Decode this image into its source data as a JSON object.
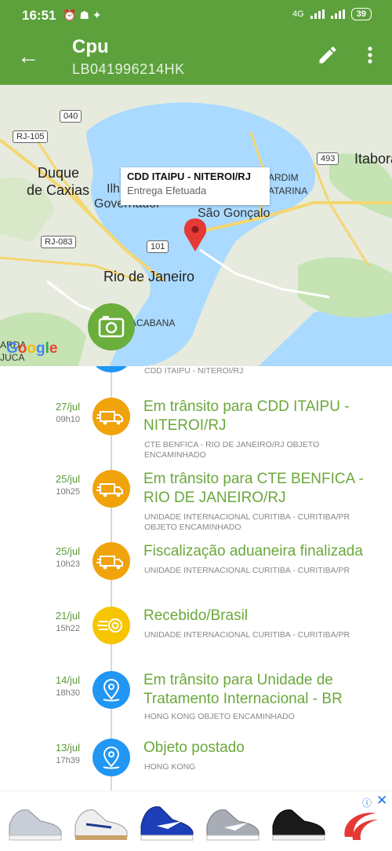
{
  "status_bar": {
    "time": "16:51",
    "network": "4G",
    "battery": "39"
  },
  "header": {
    "title": "Cpu",
    "tracking_code": "LB041996214HK"
  },
  "map": {
    "infowindow_title": "CDD ITAIPU - NITEROI/RJ",
    "infowindow_subtitle": "Entrega Efetuada",
    "labels": {
      "duque": "Duque",
      "caxias": "de Caxias",
      "ilha": "Ilh",
      "governador": "Governador",
      "sao_goncalo": "São Gonçalo",
      "rio": "Rio de Janeiro",
      "itabora": "Itabora",
      "rj105": "RJ-105",
      "rj083": "RJ-083",
      "r040": "040",
      "r101": "101",
      "r493": "493",
      "ardim": "ARDIM",
      "atarina": "ATARINA",
      "cabana": "ACABANA",
      "tijuca_a": "ARDA",
      "tijuca_b": "JUCA",
      "google": "Google"
    },
    "colors": {
      "water": "#aadaff",
      "land": "#e6ebde",
      "park": "#c5e3b3",
      "road": "#f5d670"
    }
  },
  "timeline": {
    "partial_desc": "CDD ITAIPU - NITEROI/RJ",
    "events": [
      {
        "date": "27/jul",
        "time": "09h10",
        "title": "Em trânsito para CDD ITAIPU - NITEROI/RJ",
        "desc": "CTE BENFICA - RIO DE JANEIRO/RJ OBJETO ENCAMINHADO",
        "icon": "truck-icon"
      },
      {
        "date": "25/jul",
        "time": "10h25",
        "title": "Em trânsito para CTE BENFICA - RIO DE JANEIRO/RJ",
        "desc": "UNIDADE INTERNACIONAL CURITIBA - CURITIBA/PR OBJETO ENCAMINHADO",
        "icon": "truck-icon"
      },
      {
        "date": "25/jul",
        "time": "10h23",
        "title": "Fiscalização aduaneira finalizada",
        "desc": "UNIDADE INTERNACIONAL CURITIBA - CURITIBA/PR",
        "icon": "truck-icon"
      },
      {
        "date": "21/jul",
        "time": "15h22",
        "title": "Recebido/Brasil",
        "desc": "UNIDADE INTERNACIONAL CURITIBA - CURITIBA/PR",
        "icon": "received-icon"
      },
      {
        "date": "14/jul",
        "time": "18h30",
        "title": "Em trânsito para Unidade de Tratamento Internacional - BR",
        "desc": "HONG KONG OBJETO ENCAMINHADO",
        "icon": "location-icon"
      },
      {
        "date": "13/jul",
        "time": "17h39",
        "title": "Objeto postado",
        "desc": "HONG KONG",
        "icon": "location-icon"
      }
    ]
  },
  "colors": {
    "green": "#5da13c",
    "orange": "#f0a30a",
    "yellow": "#f6c500",
    "blue": "#2196f3"
  }
}
